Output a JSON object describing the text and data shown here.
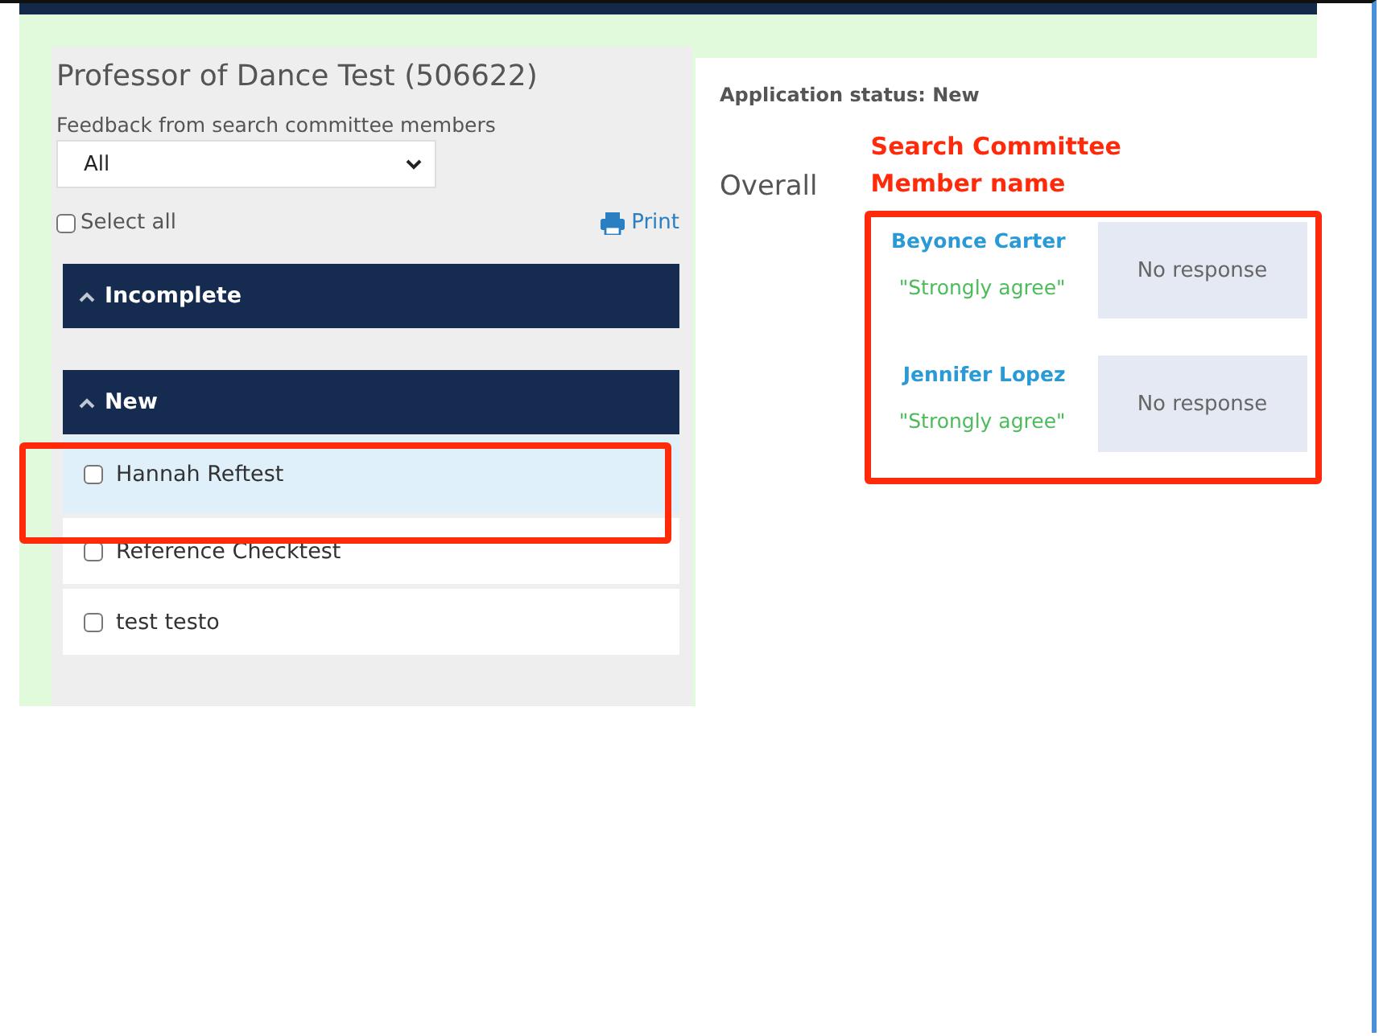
{
  "job_title": "Professor of Dance Test (506622)",
  "filter": {
    "label": "Feedback from search committee members",
    "value": "All"
  },
  "select_all": {
    "label": "Select all",
    "checked": false
  },
  "print_link": "Print",
  "groups": [
    {
      "title": "Incomplete",
      "expanded": true
    },
    {
      "title": "New",
      "expanded": true,
      "applicants": [
        {
          "name": "Hannah Reftest",
          "checked": false,
          "selected": true
        },
        {
          "name": "Reference Checktest",
          "checked": false,
          "selected": false
        },
        {
          "name": "test testo",
          "checked": false,
          "selected": false
        }
      ]
    }
  ],
  "application_status": "Application status: New",
  "section_label": "Overall",
  "annotation": "Search Committee Member name",
  "reviewers": [
    {
      "name": "Beyonce Carter",
      "rating": "\"Strongly agree\"",
      "response": "No response"
    },
    {
      "name": "Jennifer Lopez",
      "rating": "\"Strongly agree\"",
      "response": "No response"
    }
  ]
}
